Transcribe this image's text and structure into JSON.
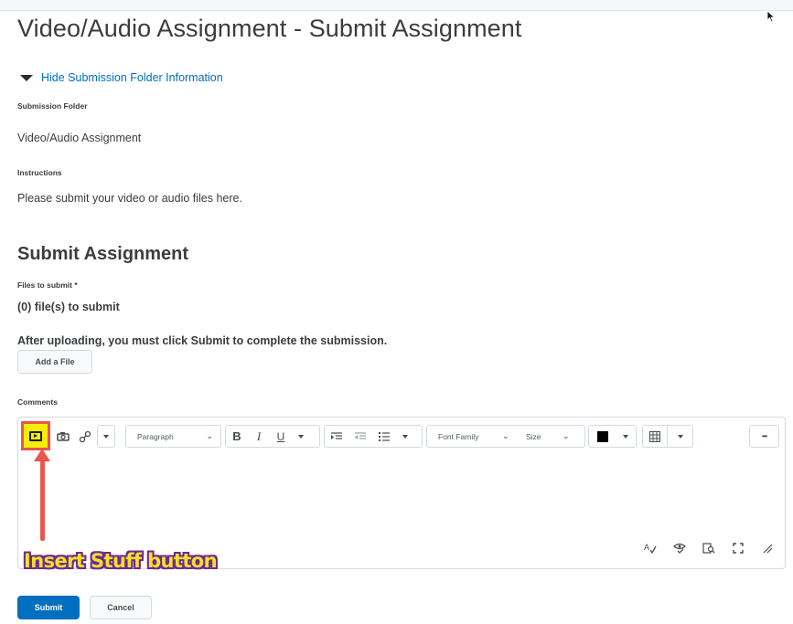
{
  "page": {
    "title": "Video/Audio Assignment - Submit Assignment",
    "toggle_label": "Hide Submission Folder Information"
  },
  "folder": {
    "label": "Submission Folder",
    "value": "Video/Audio Assignment"
  },
  "instructions": {
    "label": "Instructions",
    "value": "Please submit your video or audio files here."
  },
  "submit_section": {
    "title": "Submit Assignment",
    "files_label": "Files to submit *",
    "files_count": "(0) file(s) to submit",
    "notice": "After uploading, you must click Submit to complete the submission.",
    "add_file_label": "Add a File"
  },
  "comments": {
    "label": "Comments",
    "toolbar": {
      "paragraph": "Paragraph",
      "font_family": "Font Family",
      "size": "Size",
      "more": "•••",
      "bold": "B",
      "italic": "I",
      "underline": "U"
    }
  },
  "annotation": {
    "text": "Insert Stuff button",
    "color": "#f5df2a",
    "outline": "#6a2c91",
    "arrow_color": "#e8574d",
    "highlight": "#f5ee00"
  },
  "actions": {
    "submit_label": "Submit",
    "cancel_label": "Cancel"
  },
  "colors": {
    "link": "#006fbf",
    "primary": "#006fbf"
  }
}
